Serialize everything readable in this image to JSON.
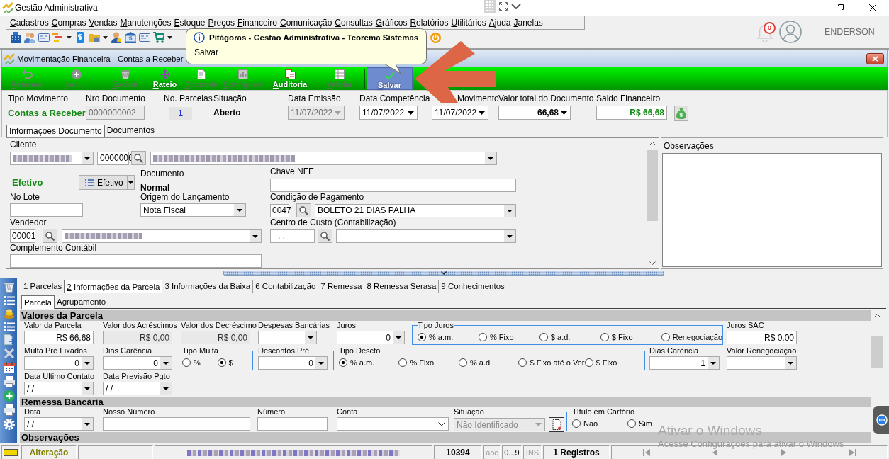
{
  "window": {
    "title": "Gestão Administrativa"
  },
  "menu": [
    "Cadastros",
    "Compras",
    "Vendas",
    "Manutenções",
    "Estoque",
    "Preços",
    "Financeiro",
    "Comunicação",
    "Consultas",
    "Gráficos",
    "Relatórios",
    "Utilitários",
    "Ajuda",
    "Janelas"
  ],
  "user": {
    "notifications": "0",
    "name": "ENDERSON"
  },
  "tooltip": {
    "title": "Pitágoras - Gestão Administrativa - Teorema Sistemas",
    "text": "Salvar"
  },
  "form_window": {
    "title": "Movimentação Financeira - Contas a Receber"
  },
  "actions": [
    {
      "label": "Retornar",
      "disabled": true,
      "hot": false
    },
    {
      "label": "Incluir",
      "disabled": true,
      "hot": false
    },
    {
      "label": "Excluir",
      "disabled": true,
      "hot": false
    },
    {
      "label": "Rateio",
      "disabled": false,
      "hot": false
    },
    {
      "label": "Documto",
      "disabled": true,
      "hot": false
    },
    {
      "label": "Configurar",
      "disabled": true,
      "hot": false
    },
    {
      "label": "Auditoria",
      "disabled": false,
      "hot": false
    },
    {
      "label": "Validar",
      "disabled": true,
      "hot": false
    },
    {
      "label": "Salvar",
      "disabled": false,
      "hot": true
    }
  ],
  "header": [
    {
      "label": "Tipo Movimento",
      "kind": "status",
      "value": "Contas a Receber"
    },
    {
      "label": "Nro Documento",
      "kind": "field",
      "value": "0000000002",
      "disabled": true
    },
    {
      "label": "No. Parcelas",
      "kind": "count",
      "value": "1"
    },
    {
      "label": "Situação",
      "kind": "text",
      "value": "Aberto"
    },
    {
      "label": "Data Emissão",
      "kind": "date",
      "value": "11/07/2022",
      "disabled": true
    },
    {
      "label": "Data Competência",
      "kind": "date",
      "value": "11/07/2022",
      "disabled": false
    },
    {
      "label": "Movimento",
      "kind": "date",
      "value": "11/07/2022",
      "disabled": false
    },
    {
      "label": "Valor total do Documento",
      "kind": "amount",
      "value": "66,68",
      "disabled": false
    },
    {
      "label": "Saldo Financeiro",
      "kind": "money",
      "value": "R$ 66,68"
    }
  ],
  "tabs": [
    {
      "label": "Informações Documento",
      "selected": true
    },
    {
      "label": "Documentos",
      "selected": false
    }
  ],
  "document": {
    "client": {
      "label": "Cliente",
      "code": "0000006"
    },
    "status": {
      "value": "Efetivo",
      "button": "Efetivo"
    },
    "document_type": {
      "label": "Documento",
      "value": "Normal"
    },
    "nfe_key": {
      "label": "Chave NFE"
    },
    "batch": {
      "label": "No Lote"
    },
    "origin": {
      "label": "Origem do Lançamento",
      "value": "Nota Fiscal"
    },
    "payment_terms": {
      "label": "Condição de Pagamento",
      "code": "0047",
      "value": "BOLETO 21 DIAS PALHA"
    },
    "seller": {
      "label": "Vendedor",
      "code": "00001"
    },
    "cost_center": {
      "label": "Centro de Custo (Contabilização)",
      "code": ". ."
    },
    "accounting_note": {
      "label": "Complemento Contábil"
    }
  },
  "observations": {
    "title": "Observações"
  },
  "detail_tabs": [
    {
      "label": "1 Parcelas",
      "selected": false
    },
    {
      "label": "2 Informações da Parcela",
      "selected": true
    },
    {
      "label": "3 Informações da Baixa",
      "selected": false
    },
    {
      "label": "6 Contabilização",
      "selected": false
    },
    {
      "label": "7 Remessa",
      "selected": false
    },
    {
      "label": "8 Remessa Serasa",
      "selected": false
    },
    {
      "label": "9 Conhecimentos",
      "selected": false
    }
  ],
  "sub_tabs": [
    {
      "label": "Parcela",
      "selected": true
    },
    {
      "label": "Agrupamento",
      "selected": false
    }
  ],
  "sections": [
    {
      "title": "Valores da Parcela",
      "rows": [
        [
          {
            "kind": "amount",
            "label": "Valor da Parcela",
            "value": "R$ 66,68",
            "disabled": false
          },
          {
            "kind": "amount",
            "label": "Valor dos Acréscimos",
            "value": "R$ 0,00",
            "disabled": true
          },
          {
            "kind": "amount",
            "label": "Valor dos Decréscimo",
            "value": "R$ 0,00",
            "disabled": true
          },
          {
            "kind": "combo",
            "label": "Despesas Bancárias",
            "disabled": false
          },
          {
            "kind": "combo",
            "label": "Juros",
            "value": "0",
            "disabled": false
          },
          {
            "kind": "radios",
            "label": "Tipo Juros",
            "options": [
              {
                "label": "% a.m.",
                "selected": true
              },
              {
                "label": "% Fixo",
                "selected": false
              },
              {
                "label": "$ a.d.",
                "selected": false
              },
              {
                "label": "$ Fixo",
                "selected": false
              },
              {
                "label": "Renegociação",
                "selected": false
              }
            ]
          },
          {
            "kind": "amount",
            "label": "Juros SAC",
            "value": "R$ 0,00",
            "disabled": false
          }
        ],
        [
          {
            "kind": "combo",
            "label": "Multa Pré Fixados",
            "value": "0",
            "disabled": false
          },
          {
            "kind": "combo",
            "label": "Dias Carência",
            "value": "0",
            "disabled": false
          },
          {
            "kind": "radios",
            "label": "Tipo Multa",
            "options": [
              {
                "label": "%",
                "selected": false
              },
              {
                "label": "$",
                "selected": true
              }
            ]
          },
          {
            "kind": "combo",
            "label": "Descontos Pré",
            "value": "0",
            "disabled": false
          },
          {
            "kind": "radios",
            "label": "Tipo Descto",
            "options": [
              {
                "label": "% a.m.",
                "selected": true
              },
              {
                "label": "% Fixo",
                "selected": false
              },
              {
                "label": "% a.d.",
                "selected": false
              },
              {
                "label": "$ Fixo até o Ver",
                "selected": false
              },
              {
                "label": "$ Fixo",
                "selected": false
              }
            ]
          },
          {
            "kind": "combo",
            "label": "Dias Carência",
            "value": "1",
            "disabled": false
          },
          {
            "kind": "combo",
            "label": "Valor Renegociação",
            "disabled": false
          }
        ],
        [
          {
            "kind": "date",
            "label": "Data Ultimo Contato",
            "value": "/ /",
            "disabled": false
          },
          {
            "kind": "date",
            "label": "Data Previsão Pgto",
            "value": "/ /",
            "disabled": false
          }
        ]
      ]
    },
    {
      "title": "Remessa Bancária",
      "rows": [
        [
          {
            "kind": "date",
            "label": "Data",
            "value": "/ /",
            "disabled": false
          },
          {
            "kind": "text",
            "label": "Nosso Número",
            "disabled": false
          },
          {
            "kind": "text",
            "label": "Número",
            "disabled": false
          },
          {
            "kind": "select",
            "label": "Conta",
            "disabled": false
          },
          {
            "kind": "combo_button",
            "label": "Situação",
            "value": "Não Identificado",
            "disabled": true
          },
          {
            "kind": "radios",
            "label": "Título em Cartório",
            "options": [
              {
                "label": "Não",
                "selected": false
              },
              {
                "label": "Sim",
                "selected": false
              }
            ]
          }
        ]
      ]
    },
    {
      "title": "Observações"
    }
  ],
  "status_bar": {
    "mode": "Alteração",
    "code": "10394",
    "indicators": [
      {
        "label": "abc",
        "active": false
      },
      {
        "label": "0...9",
        "active": true
      },
      {
        "label": "INS",
        "active": false
      }
    ],
    "records": "1 Registros"
  },
  "os_notice": {
    "title": "Ativar o Windows",
    "text": "Acesse Configurações para ativar o Windows"
  }
}
